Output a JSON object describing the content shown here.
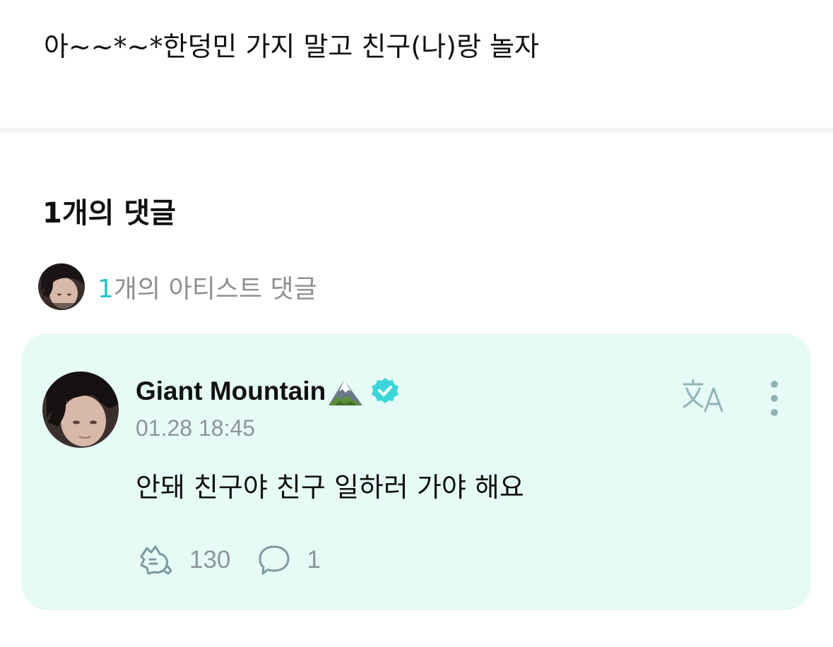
{
  "post": {
    "text": "아~~*~*한덩민 가지 말고 친구(나)랑 놀자"
  },
  "comments_section": {
    "heading": "1개의 댓글",
    "artist_summary": {
      "count": "1",
      "label": "개의 아티스트 댓글"
    }
  },
  "comment": {
    "author": "Giant Mountain",
    "author_emoji_icon": "snow-capped-mountain-icon",
    "verified_icon": "verified-badge-icon",
    "timestamp": "01.28 18:45",
    "body": "안돼 친구야 친구 일하러 가야 해요",
    "translate_icon": "translate-icon",
    "more_icon": "more-vertical-icon",
    "reactions": {
      "like_icon": "cheer-hand-icon",
      "like_count": "130",
      "reply_icon": "speech-bubble-icon",
      "reply_count": "1"
    }
  },
  "colors": {
    "accent": "#25c4c8",
    "card_background": "#e6faf6",
    "muted_text": "#8e949a",
    "divider": "#f2f3f5"
  }
}
